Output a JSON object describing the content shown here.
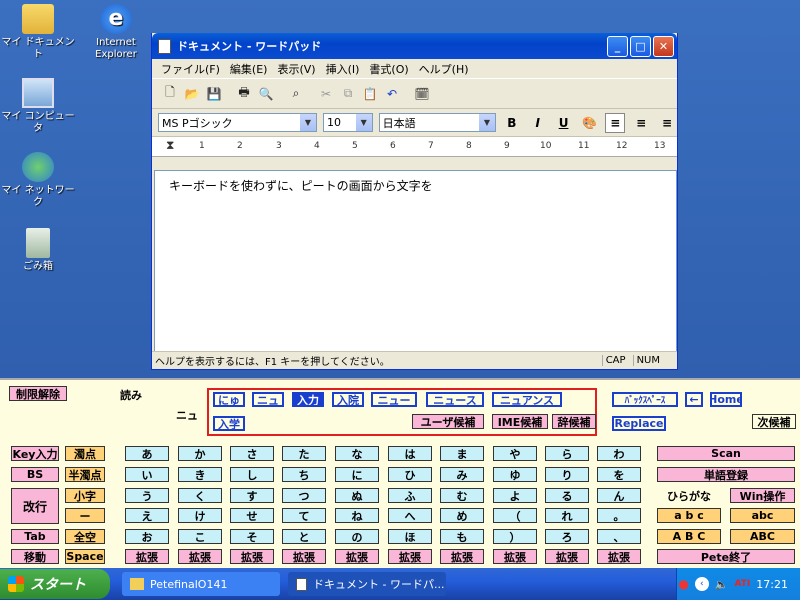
{
  "desktop_icons": [
    {
      "label": "マイ ドキュメント",
      "icon": "folder-icon"
    },
    {
      "label": "Internet Explorer",
      "icon": "ie-icon"
    },
    {
      "label": "マイ コンピュータ",
      "icon": "computer-icon"
    },
    {
      "label": "マイ ネットワーク",
      "icon": "network-icon"
    },
    {
      "label": "ごみ箱",
      "icon": "recycle-bin-icon"
    }
  ],
  "window": {
    "title": "ドキュメント - ワードパッド",
    "menu": [
      "ファイル(F)",
      "編集(E)",
      "表示(V)",
      "挿入(I)",
      "書式(O)",
      "ヘルプ(H)"
    ],
    "font_name": "MS Pゴシック",
    "font_size": "10",
    "script": "日本語",
    "ruler": [
      "1",
      "2",
      "3",
      "4",
      "5",
      "6",
      "7",
      "8",
      "9",
      "10",
      "11",
      "12",
      "13"
    ],
    "body_text": "キーボードを使わずに、ピートの画面から文字を",
    "status": "ヘルプを表示するには、F1 キーを押してください。",
    "caps": "CAP",
    "num": "NUM"
  },
  "keyboard": {
    "top": {
      "restrict": "制限解除",
      "yomi_label": "読み",
      "reading": "ニュ",
      "candidates_row1": [
        "にゅ",
        "ニュ",
        "入力",
        "入院",
        "ニュー",
        "ニュース",
        "ニュアンス"
      ],
      "candidates_row2": [
        "入学",
        "ユーザ候補",
        "IME候補",
        "辞候補"
      ],
      "backspace": "ﾊﾞｯｸｽﾍﾟｰｽ",
      "left_arrow": "←",
      "home": "Home",
      "replace": "Replace",
      "next_candidate": "次候補"
    },
    "left_keys": [
      "Key入力",
      "BS",
      "改行",
      "Tab",
      "移動"
    ],
    "second_keys": [
      "濁点",
      "半濁点",
      "小字",
      "ー",
      "全空",
      "Space"
    ],
    "kana_rows": [
      [
        "あ",
        "か",
        "さ",
        "た",
        "な",
        "は",
        "ま",
        "や",
        "ら",
        "わ"
      ],
      [
        "い",
        "き",
        "し",
        "ち",
        "に",
        "ひ",
        "み",
        "ゆ",
        "り",
        "を"
      ],
      [
        "う",
        "く",
        "す",
        "つ",
        "ぬ",
        "ふ",
        "む",
        "よ",
        "る",
        "ん"
      ],
      [
        "え",
        "け",
        "せ",
        "て",
        "ね",
        "へ",
        "め",
        "（",
        "れ",
        "。"
      ],
      [
        "お",
        "こ",
        "そ",
        "と",
        "の",
        "ほ",
        "も",
        "）",
        "ろ",
        "、"
      ]
    ],
    "extend_label": "拡張",
    "right_keys": {
      "scan": "Scan",
      "register": "単語登録",
      "hiragana": "ひらがな",
      "win_op": "Win操作",
      "lower_sp": "a b c",
      "lower": "abc",
      "upper_sp": "A B C",
      "upper": "ABC",
      "quit": "Pete終了"
    }
  },
  "taskbar": {
    "start": "スタート",
    "tasks": [
      "PetefinalO141",
      "ドキュメント - ワードパ..."
    ],
    "clock": "17:21"
  }
}
